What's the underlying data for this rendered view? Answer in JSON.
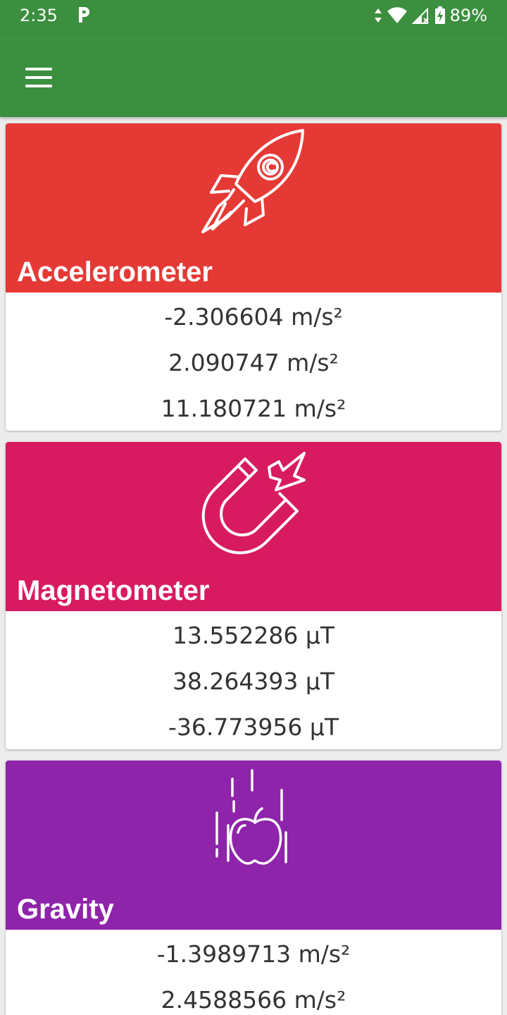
{
  "status_bar": {
    "time": "2:35",
    "battery_percent": "89%",
    "icons": [
      "parking-notification-icon",
      "data-arrows-icon",
      "wifi-icon",
      "cell-signal-icon",
      "battery-charging-icon"
    ]
  },
  "app_bar": {
    "menu_icon": "hamburger-menu-icon",
    "color": "#3b8f3f"
  },
  "sensors": [
    {
      "title": "Accelerometer",
      "icon": "rocket-icon",
      "color": "#e53935",
      "values": [
        "-2.306604 m/s²",
        "2.090747 m/s²",
        "11.180721 m/s²"
      ]
    },
    {
      "title": "Magnetometer",
      "icon": "magnet-icon",
      "color": "#d81b60",
      "values": [
        "13.552286 µT",
        "38.264393 µT",
        "-36.773956 µT"
      ]
    },
    {
      "title": "Gravity",
      "icon": "falling-apple-icon",
      "color": "#8e24aa",
      "values": [
        "-1.3989713 m/s²",
        "2.4588566 m/s²"
      ]
    }
  ]
}
